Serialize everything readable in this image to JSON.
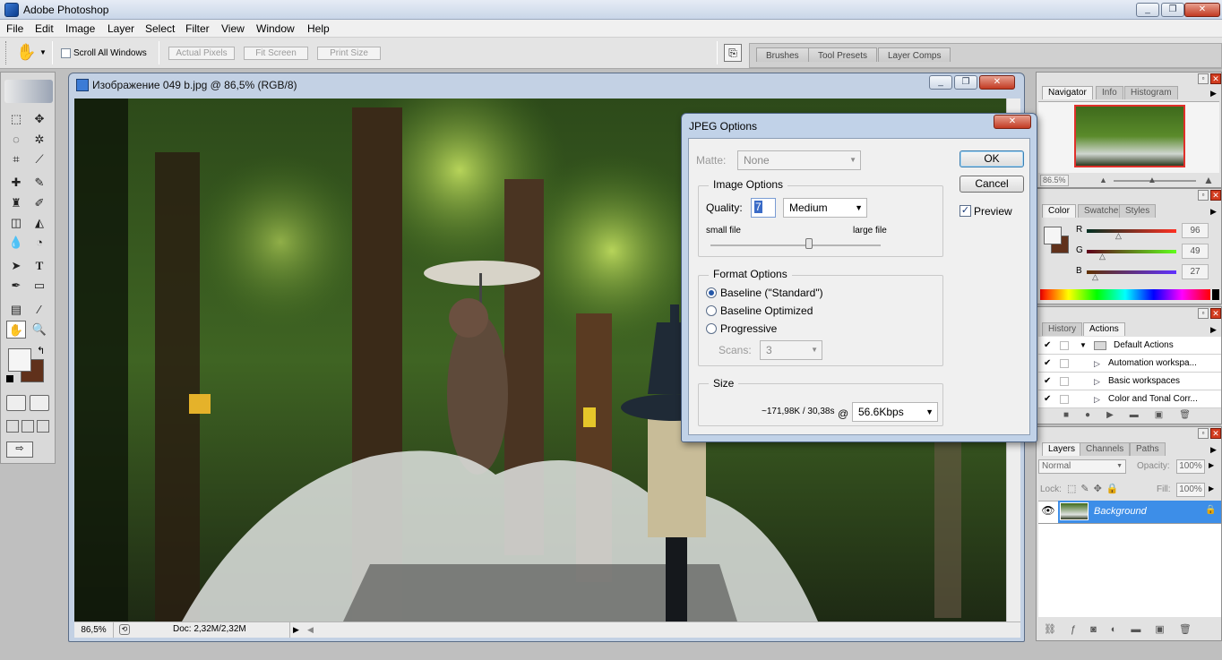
{
  "app": {
    "title": "Adobe Photoshop"
  },
  "menu": [
    "File",
    "Edit",
    "Image",
    "Layer",
    "Select",
    "Filter",
    "View",
    "Window",
    "Help"
  ],
  "options_bar": {
    "scroll_all": "Scroll All Windows",
    "actual_pixels": "Actual Pixels",
    "fit_screen": "Fit Screen",
    "print_size": "Print Size"
  },
  "palette_well": [
    "Brushes",
    "Tool Presets",
    "Layer Comps"
  ],
  "document": {
    "title": "Изображение 049 b.jpg @ 86,5% (RGB/8)",
    "zoom": "86,5%",
    "doc_size": "Doc: 2,32M/2,32M"
  },
  "dialog": {
    "title": "JPEG Options",
    "matte_label": "Matte:",
    "matte_value": "None",
    "image_options": "Image Options",
    "quality_label": "Quality:",
    "quality_value": "7",
    "quality_preset": "Medium",
    "small_file": "small file",
    "large_file": "large file",
    "quality_slider_fraction": 0.58,
    "format_options": "Format Options",
    "baseline_standard": "Baseline (\"Standard\")",
    "baseline_optimized": "Baseline Optimized",
    "progressive": "Progressive",
    "scans_label": "Scans:",
    "scans_value": "3",
    "size_label": "Size",
    "size_value": "~171,98K / 30,38s",
    "at": "@",
    "speed": "56.6Kbps",
    "ok": "OK",
    "cancel": "Cancel",
    "preview": "Preview"
  },
  "navigator": {
    "tabs": [
      "Navigator",
      "Info",
      "Histogram"
    ],
    "zoom": "86.5%"
  },
  "color": {
    "tabs": [
      "Color",
      "Swatches",
      "Styles"
    ],
    "r": "96",
    "g": "49",
    "b": "27",
    "fg": "#f5f5f5",
    "bg": "#60311b"
  },
  "history": {
    "tabs": [
      "History",
      "Actions"
    ],
    "items": [
      "Default Actions",
      "Automation workspa...",
      "Basic workspaces",
      "Color and Tonal Corr..."
    ]
  },
  "layers": {
    "tabs": [
      "Layers",
      "Channels",
      "Paths"
    ],
    "blend": "Normal",
    "opacity_label": "Opacity:",
    "opacity": "100%",
    "lock_label": "Lock:",
    "fill_label": "Fill:",
    "fill": "100%",
    "layer_name": "Background"
  }
}
